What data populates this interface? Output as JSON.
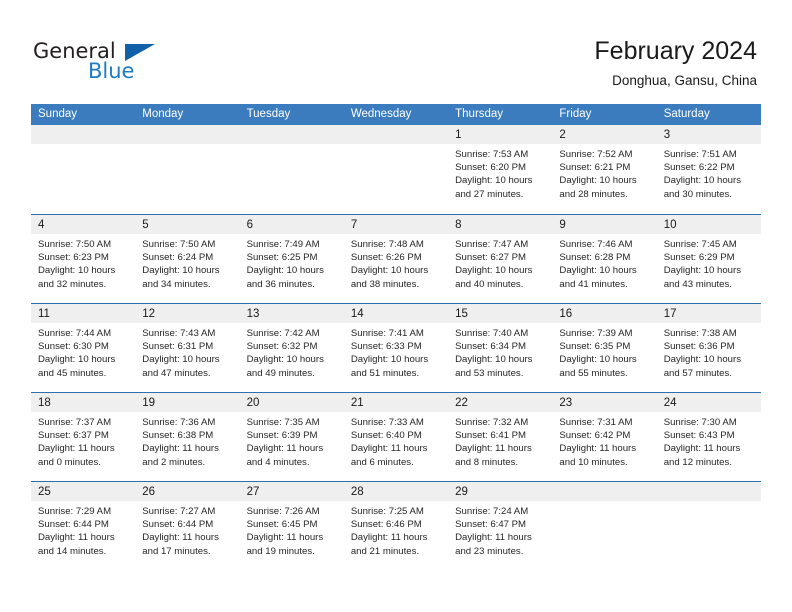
{
  "brand": {
    "name_part1": "General",
    "name_part2": "Blue",
    "flag_icon": "triangle-flag-icon",
    "accent_color": "#1261a8",
    "text_color": "#231f20"
  },
  "header": {
    "title": "February 2024",
    "subtitle": "Donghua, Gansu, China"
  },
  "calendar": {
    "header_bg": "#3b7cbe",
    "daynum_bg": "#efefef",
    "row_divider": "#2f6fae",
    "weekdays": [
      "Sunday",
      "Monday",
      "Tuesday",
      "Wednesday",
      "Thursday",
      "Friday",
      "Saturday"
    ],
    "weeks": [
      [
        {
          "day": "",
          "lines": []
        },
        {
          "day": "",
          "lines": []
        },
        {
          "day": "",
          "lines": []
        },
        {
          "day": "",
          "lines": []
        },
        {
          "day": "1",
          "lines": [
            "Sunrise: 7:53 AM",
            "Sunset: 6:20 PM",
            "Daylight: 10 hours",
            "and 27 minutes."
          ]
        },
        {
          "day": "2",
          "lines": [
            "Sunrise: 7:52 AM",
            "Sunset: 6:21 PM",
            "Daylight: 10 hours",
            "and 28 minutes."
          ]
        },
        {
          "day": "3",
          "lines": [
            "Sunrise: 7:51 AM",
            "Sunset: 6:22 PM",
            "Daylight: 10 hours",
            "and 30 minutes."
          ]
        }
      ],
      [
        {
          "day": "4",
          "lines": [
            "Sunrise: 7:50 AM",
            "Sunset: 6:23 PM",
            "Daylight: 10 hours",
            "and 32 minutes."
          ]
        },
        {
          "day": "5",
          "lines": [
            "Sunrise: 7:50 AM",
            "Sunset: 6:24 PM",
            "Daylight: 10 hours",
            "and 34 minutes."
          ]
        },
        {
          "day": "6",
          "lines": [
            "Sunrise: 7:49 AM",
            "Sunset: 6:25 PM",
            "Daylight: 10 hours",
            "and 36 minutes."
          ]
        },
        {
          "day": "7",
          "lines": [
            "Sunrise: 7:48 AM",
            "Sunset: 6:26 PM",
            "Daylight: 10 hours",
            "and 38 minutes."
          ]
        },
        {
          "day": "8",
          "lines": [
            "Sunrise: 7:47 AM",
            "Sunset: 6:27 PM",
            "Daylight: 10 hours",
            "and 40 minutes."
          ]
        },
        {
          "day": "9",
          "lines": [
            "Sunrise: 7:46 AM",
            "Sunset: 6:28 PM",
            "Daylight: 10 hours",
            "and 41 minutes."
          ]
        },
        {
          "day": "10",
          "lines": [
            "Sunrise: 7:45 AM",
            "Sunset: 6:29 PM",
            "Daylight: 10 hours",
            "and 43 minutes."
          ]
        }
      ],
      [
        {
          "day": "11",
          "lines": [
            "Sunrise: 7:44 AM",
            "Sunset: 6:30 PM",
            "Daylight: 10 hours",
            "and 45 minutes."
          ]
        },
        {
          "day": "12",
          "lines": [
            "Sunrise: 7:43 AM",
            "Sunset: 6:31 PM",
            "Daylight: 10 hours",
            "and 47 minutes."
          ]
        },
        {
          "day": "13",
          "lines": [
            "Sunrise: 7:42 AM",
            "Sunset: 6:32 PM",
            "Daylight: 10 hours",
            "and 49 minutes."
          ]
        },
        {
          "day": "14",
          "lines": [
            "Sunrise: 7:41 AM",
            "Sunset: 6:33 PM",
            "Daylight: 10 hours",
            "and 51 minutes."
          ]
        },
        {
          "day": "15",
          "lines": [
            "Sunrise: 7:40 AM",
            "Sunset: 6:34 PM",
            "Daylight: 10 hours",
            "and 53 minutes."
          ]
        },
        {
          "day": "16",
          "lines": [
            "Sunrise: 7:39 AM",
            "Sunset: 6:35 PM",
            "Daylight: 10 hours",
            "and 55 minutes."
          ]
        },
        {
          "day": "17",
          "lines": [
            "Sunrise: 7:38 AM",
            "Sunset: 6:36 PM",
            "Daylight: 10 hours",
            "and 57 minutes."
          ]
        }
      ],
      [
        {
          "day": "18",
          "lines": [
            "Sunrise: 7:37 AM",
            "Sunset: 6:37 PM",
            "Daylight: 11 hours",
            "and 0 minutes."
          ]
        },
        {
          "day": "19",
          "lines": [
            "Sunrise: 7:36 AM",
            "Sunset: 6:38 PM",
            "Daylight: 11 hours",
            "and 2 minutes."
          ]
        },
        {
          "day": "20",
          "lines": [
            "Sunrise: 7:35 AM",
            "Sunset: 6:39 PM",
            "Daylight: 11 hours",
            "and 4 minutes."
          ]
        },
        {
          "day": "21",
          "lines": [
            "Sunrise: 7:33 AM",
            "Sunset: 6:40 PM",
            "Daylight: 11 hours",
            "and 6 minutes."
          ]
        },
        {
          "day": "22",
          "lines": [
            "Sunrise: 7:32 AM",
            "Sunset: 6:41 PM",
            "Daylight: 11 hours",
            "and 8 minutes."
          ]
        },
        {
          "day": "23",
          "lines": [
            "Sunrise: 7:31 AM",
            "Sunset: 6:42 PM",
            "Daylight: 11 hours",
            "and 10 minutes."
          ]
        },
        {
          "day": "24",
          "lines": [
            "Sunrise: 7:30 AM",
            "Sunset: 6:43 PM",
            "Daylight: 11 hours",
            "and 12 minutes."
          ]
        }
      ],
      [
        {
          "day": "25",
          "lines": [
            "Sunrise: 7:29 AM",
            "Sunset: 6:44 PM",
            "Daylight: 11 hours",
            "and 14 minutes."
          ]
        },
        {
          "day": "26",
          "lines": [
            "Sunrise: 7:27 AM",
            "Sunset: 6:44 PM",
            "Daylight: 11 hours",
            "and 17 minutes."
          ]
        },
        {
          "day": "27",
          "lines": [
            "Sunrise: 7:26 AM",
            "Sunset: 6:45 PM",
            "Daylight: 11 hours",
            "and 19 minutes."
          ]
        },
        {
          "day": "28",
          "lines": [
            "Sunrise: 7:25 AM",
            "Sunset: 6:46 PM",
            "Daylight: 11 hours",
            "and 21 minutes."
          ]
        },
        {
          "day": "29",
          "lines": [
            "Sunrise: 7:24 AM",
            "Sunset: 6:47 PM",
            "Daylight: 11 hours",
            "and 23 minutes."
          ]
        },
        {
          "day": "",
          "lines": []
        },
        {
          "day": "",
          "lines": []
        }
      ]
    ]
  }
}
